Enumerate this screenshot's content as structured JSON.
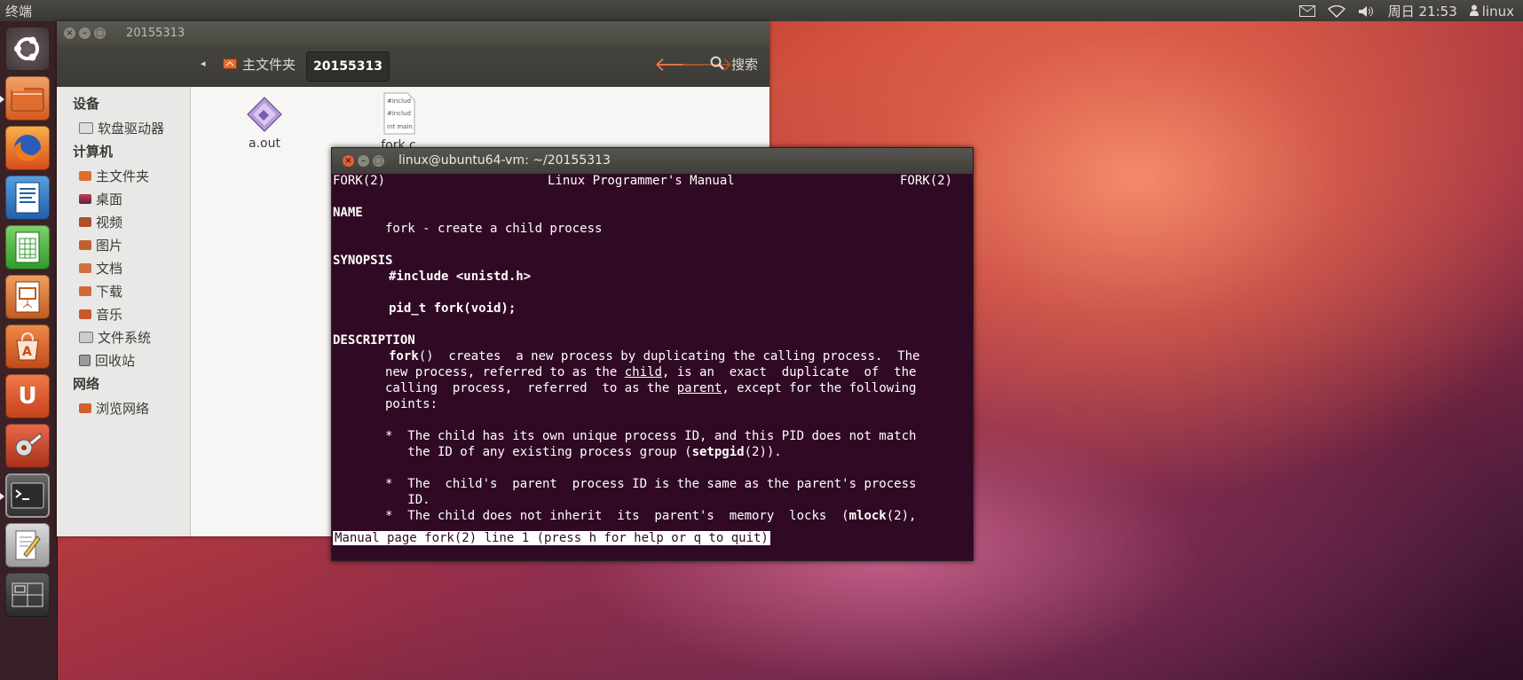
{
  "top_panel": {
    "app_title": "终端",
    "clock": "周日 21:53",
    "user": "linux"
  },
  "launcher": {
    "items": [
      {
        "name": "dash-home",
        "icon": "ubuntu-logo-icon"
      },
      {
        "name": "files",
        "icon": "folder-icon"
      },
      {
        "name": "firefox",
        "icon": "firefox-icon"
      },
      {
        "name": "writer",
        "icon": "document-icon"
      },
      {
        "name": "calc",
        "icon": "spreadsheet-icon"
      },
      {
        "name": "impress",
        "icon": "presentation-icon"
      },
      {
        "name": "software-center",
        "icon": "software-center-icon"
      },
      {
        "name": "ubuntu-one",
        "icon": "ubuntu-one-icon",
        "glyph": "U"
      },
      {
        "name": "system-settings",
        "icon": "settings-icon"
      },
      {
        "name": "terminal",
        "icon": "terminal-icon"
      },
      {
        "name": "text-editor",
        "icon": "text-editor-icon"
      },
      {
        "name": "workspaces",
        "icon": "workspace-switcher-icon"
      }
    ]
  },
  "file_manager": {
    "window_title": "20155313",
    "breadcrumb_home": "主文件夹",
    "breadcrumb_current": "20155313",
    "search_label": "搜索",
    "sidebar": {
      "devices_heading": "设备",
      "devices": [
        "软盘驱动器"
      ],
      "computer_heading": "计算机",
      "computer": [
        "主文件夹",
        "桌面",
        "视频",
        "图片",
        "文档",
        "下载",
        "音乐",
        "文件系统",
        "回收站"
      ],
      "network_heading": "网络",
      "network": [
        "浏览网络"
      ]
    },
    "files": [
      {
        "name": "a.out",
        "type": "executable"
      },
      {
        "name": "fork.c",
        "type": "c-source",
        "preview": [
          "#includ",
          "#includ",
          "int main"
        ]
      }
    ]
  },
  "terminal": {
    "window_title": "linux@ubuntu64-vm: ~/20155313",
    "header_left": "FORK(2)",
    "header_center": "Linux Programmer's Manual",
    "header_right": "FORK(2)",
    "name_heading": "NAME",
    "name_text": "       fork - create a child process",
    "synopsis_heading": "SYNOPSIS",
    "synopsis_include": "#include <unistd.h>",
    "synopsis_proto": "pid_t fork(void);",
    "description_heading": "DESCRIPTION",
    "desc_fork": "fork",
    "desc_l1_rest": "()  creates  a new process by duplicating the calling process.  The",
    "desc_l2_pre": "       new process, referred to as the ",
    "desc_child": "child",
    "desc_l2_post": ", is an  exact  duplicate  of  the",
    "desc_l3_pre": "       calling  process,  referred  to as the ",
    "desc_parent": "parent",
    "desc_l3_post": ", except for the following",
    "desc_l4": "       points:",
    "bullet1_l1": "       *  The child has its own unique process ID, and this PID does not match",
    "bullet1_l2_pre": "          the ID of any existing process group (",
    "bullet1_setpgid": "setpgid",
    "bullet1_l2_post": "(2)).",
    "bullet2_l1": "       *  The  child's  parent  process ID is the same as the parent's process",
    "bullet2_l2": "          ID.",
    "bullet3_l1_pre": "       *  The child does not inherit  its  parent's  memory  locks  (",
    "bullet3_mlock": "mlock",
    "bullet3_l1_post": "(2),",
    "status_line": "Manual page fork(2) line 1 (press h for help or q to quit)"
  }
}
